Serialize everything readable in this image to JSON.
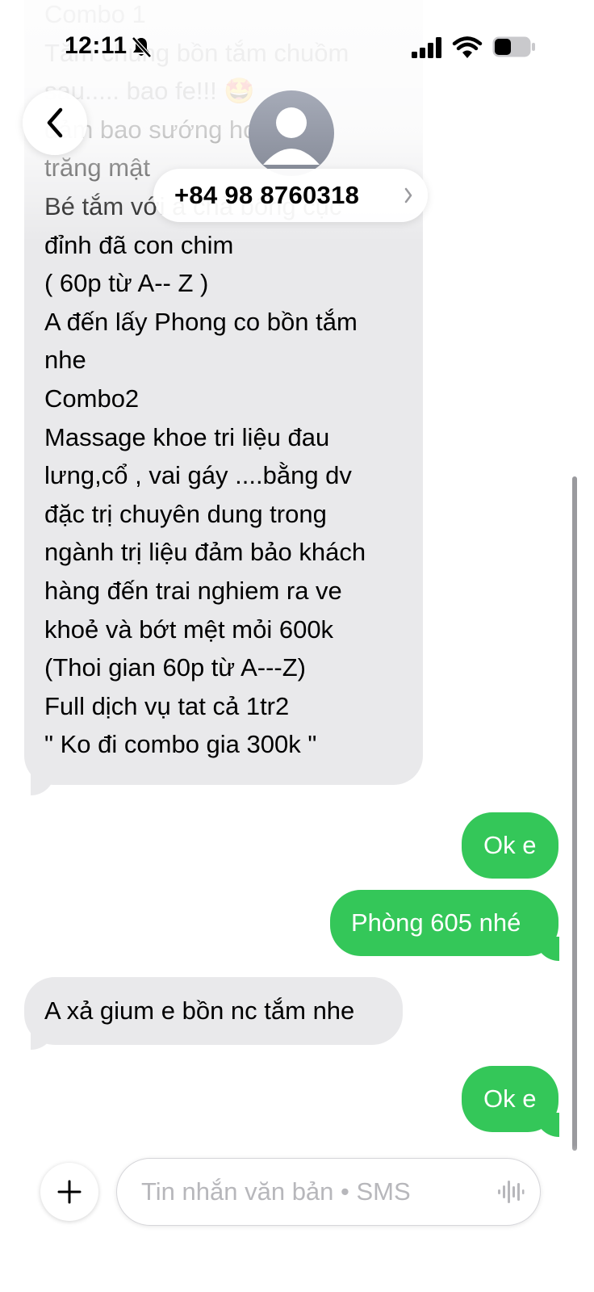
{
  "status_bar": {
    "time": "12:11"
  },
  "header": {
    "contact": "+84 98 8760318",
    "icons": [
      "back-chevron-icon",
      "contact-avatar-icon",
      "chevron-right-icon"
    ]
  },
  "messages": {
    "long_message_lines": [
      "Combo 1",
      "Tắm chung bồn tắm chuồm",
      "sau..... bao fe!!! 🤩",
      "đảm bao sướng hơn tuần",
      "trăng mật",
      "Bé tắm với a chà bông cục",
      "đỉnh đã con chim",
      "( 60p từ A-- Z )",
      "A đến lấy Phong co bồn tắm",
      "nhe",
      "Combo2",
      "Massage khoe tri liệu  đau",
      "lưng,cổ , vai gáy ....bằng dv",
      "đặc trị chuyên dung trong",
      "ngành trị liệu đảm bảo khách",
      "hàng đến trai nghiem ra ve",
      "khoẻ và bớt mệt mỏi 600k",
      "(Thoi gian 60p từ A---Z)",
      "Full dịch vụ tat cả 1tr2",
      "\" Ko đi combo gia 300k \""
    ],
    "sent_1": "Ok e",
    "sent_2": "Phòng 605 nhé",
    "received_2": "A xả gium e bồn nc tắm nhe",
    "sent_3": "Ok e"
  },
  "compose": {
    "placeholder": "Tin nhắn văn bản • SMS",
    "icons": [
      "plus-icon",
      "waveform-icon"
    ]
  },
  "colors": {
    "sent_bubble": "#34c759",
    "received_bubble": "#e9e9eb"
  }
}
